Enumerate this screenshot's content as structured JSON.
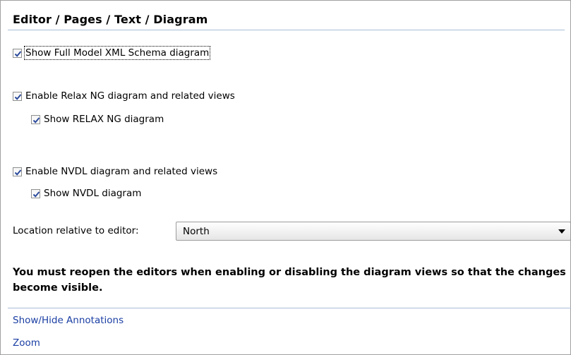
{
  "page": {
    "title": "Editor / Pages / Text / Diagram"
  },
  "checkboxes": {
    "show_full_model": {
      "label": "Show Full Model XML Schema diagram",
      "checked": true
    },
    "enable_relax_ng": {
      "label": "Enable Relax NG diagram and related views",
      "checked": true
    },
    "show_relax_ng": {
      "label": "Show RELAX NG diagram",
      "checked": true
    },
    "enable_nvdl": {
      "label": "Enable NVDL diagram and related views",
      "checked": true
    },
    "show_nvdl": {
      "label": "Show NVDL diagram",
      "checked": true
    }
  },
  "location": {
    "label": "Location relative to editor:",
    "value": "North"
  },
  "notice": "You must reopen the editors when enabling or disabling the diagram views so that the changes become visible.",
  "links": {
    "annotations": "Show/Hide Annotations",
    "zoom": "Zoom"
  },
  "colors": {
    "link": "#1a3ea3",
    "checkmark": "#2b4a9b",
    "rule": "#a9bcd6"
  },
  "icons": {
    "checkmark": "checkmark-icon",
    "dropdown": "dropdown-arrow-icon"
  }
}
